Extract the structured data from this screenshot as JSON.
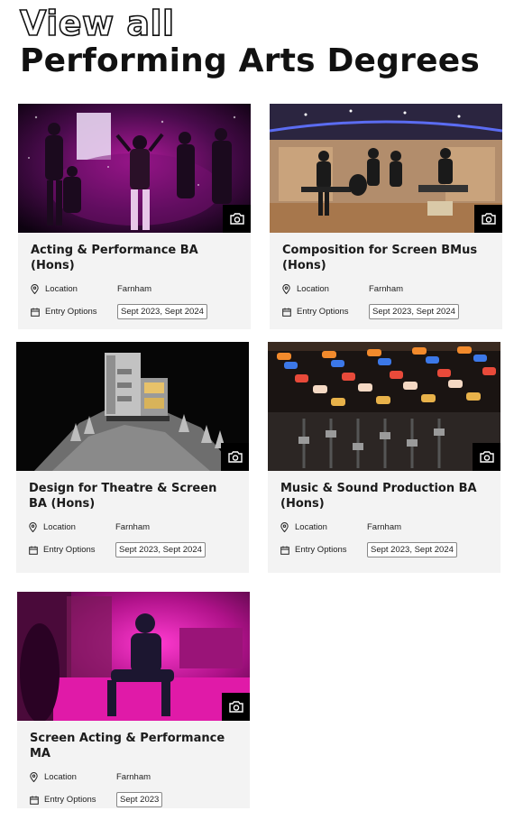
{
  "page": {
    "heading_line1": "View all",
    "heading_line2": "Performing Arts Degrees"
  },
  "courses": [
    {
      "title": "Acting & Performance BA (Hons)",
      "location_label": "Location",
      "location": "Farnham",
      "entry_label": "Entry Options",
      "entry": "Sept 2023, Sept 2024"
    },
    {
      "title": "Composition for Screen BMus (Hons)",
      "location_label": "Location",
      "location": "Farnham",
      "entry_label": "Entry Options",
      "entry": "Sept 2023, Sept 2024"
    },
    {
      "title": "Design for Theatre & Screen BA (Hons)",
      "location_label": "Location",
      "location": "Farnham",
      "entry_label": "Entry Options",
      "entry": "Sept 2023, Sept 2024"
    },
    {
      "title": "Music & Sound Production BA (Hons)",
      "location_label": "Location",
      "location": "Farnham",
      "entry_label": "Entry Options",
      "entry": "Sept 2023, Sept 2024"
    },
    {
      "title": "Screen Acting & Performance MA",
      "location_label": "Location",
      "location": "Farnham",
      "entry_label": "Entry Options",
      "entry": "Sept 2023"
    }
  ],
  "icons": {
    "photo": "camera-icon",
    "location": "location-pin-icon",
    "entry": "calendar-icon"
  },
  "colors": {
    "card_bg": "#f3f3f3",
    "heading": "#111111"
  }
}
